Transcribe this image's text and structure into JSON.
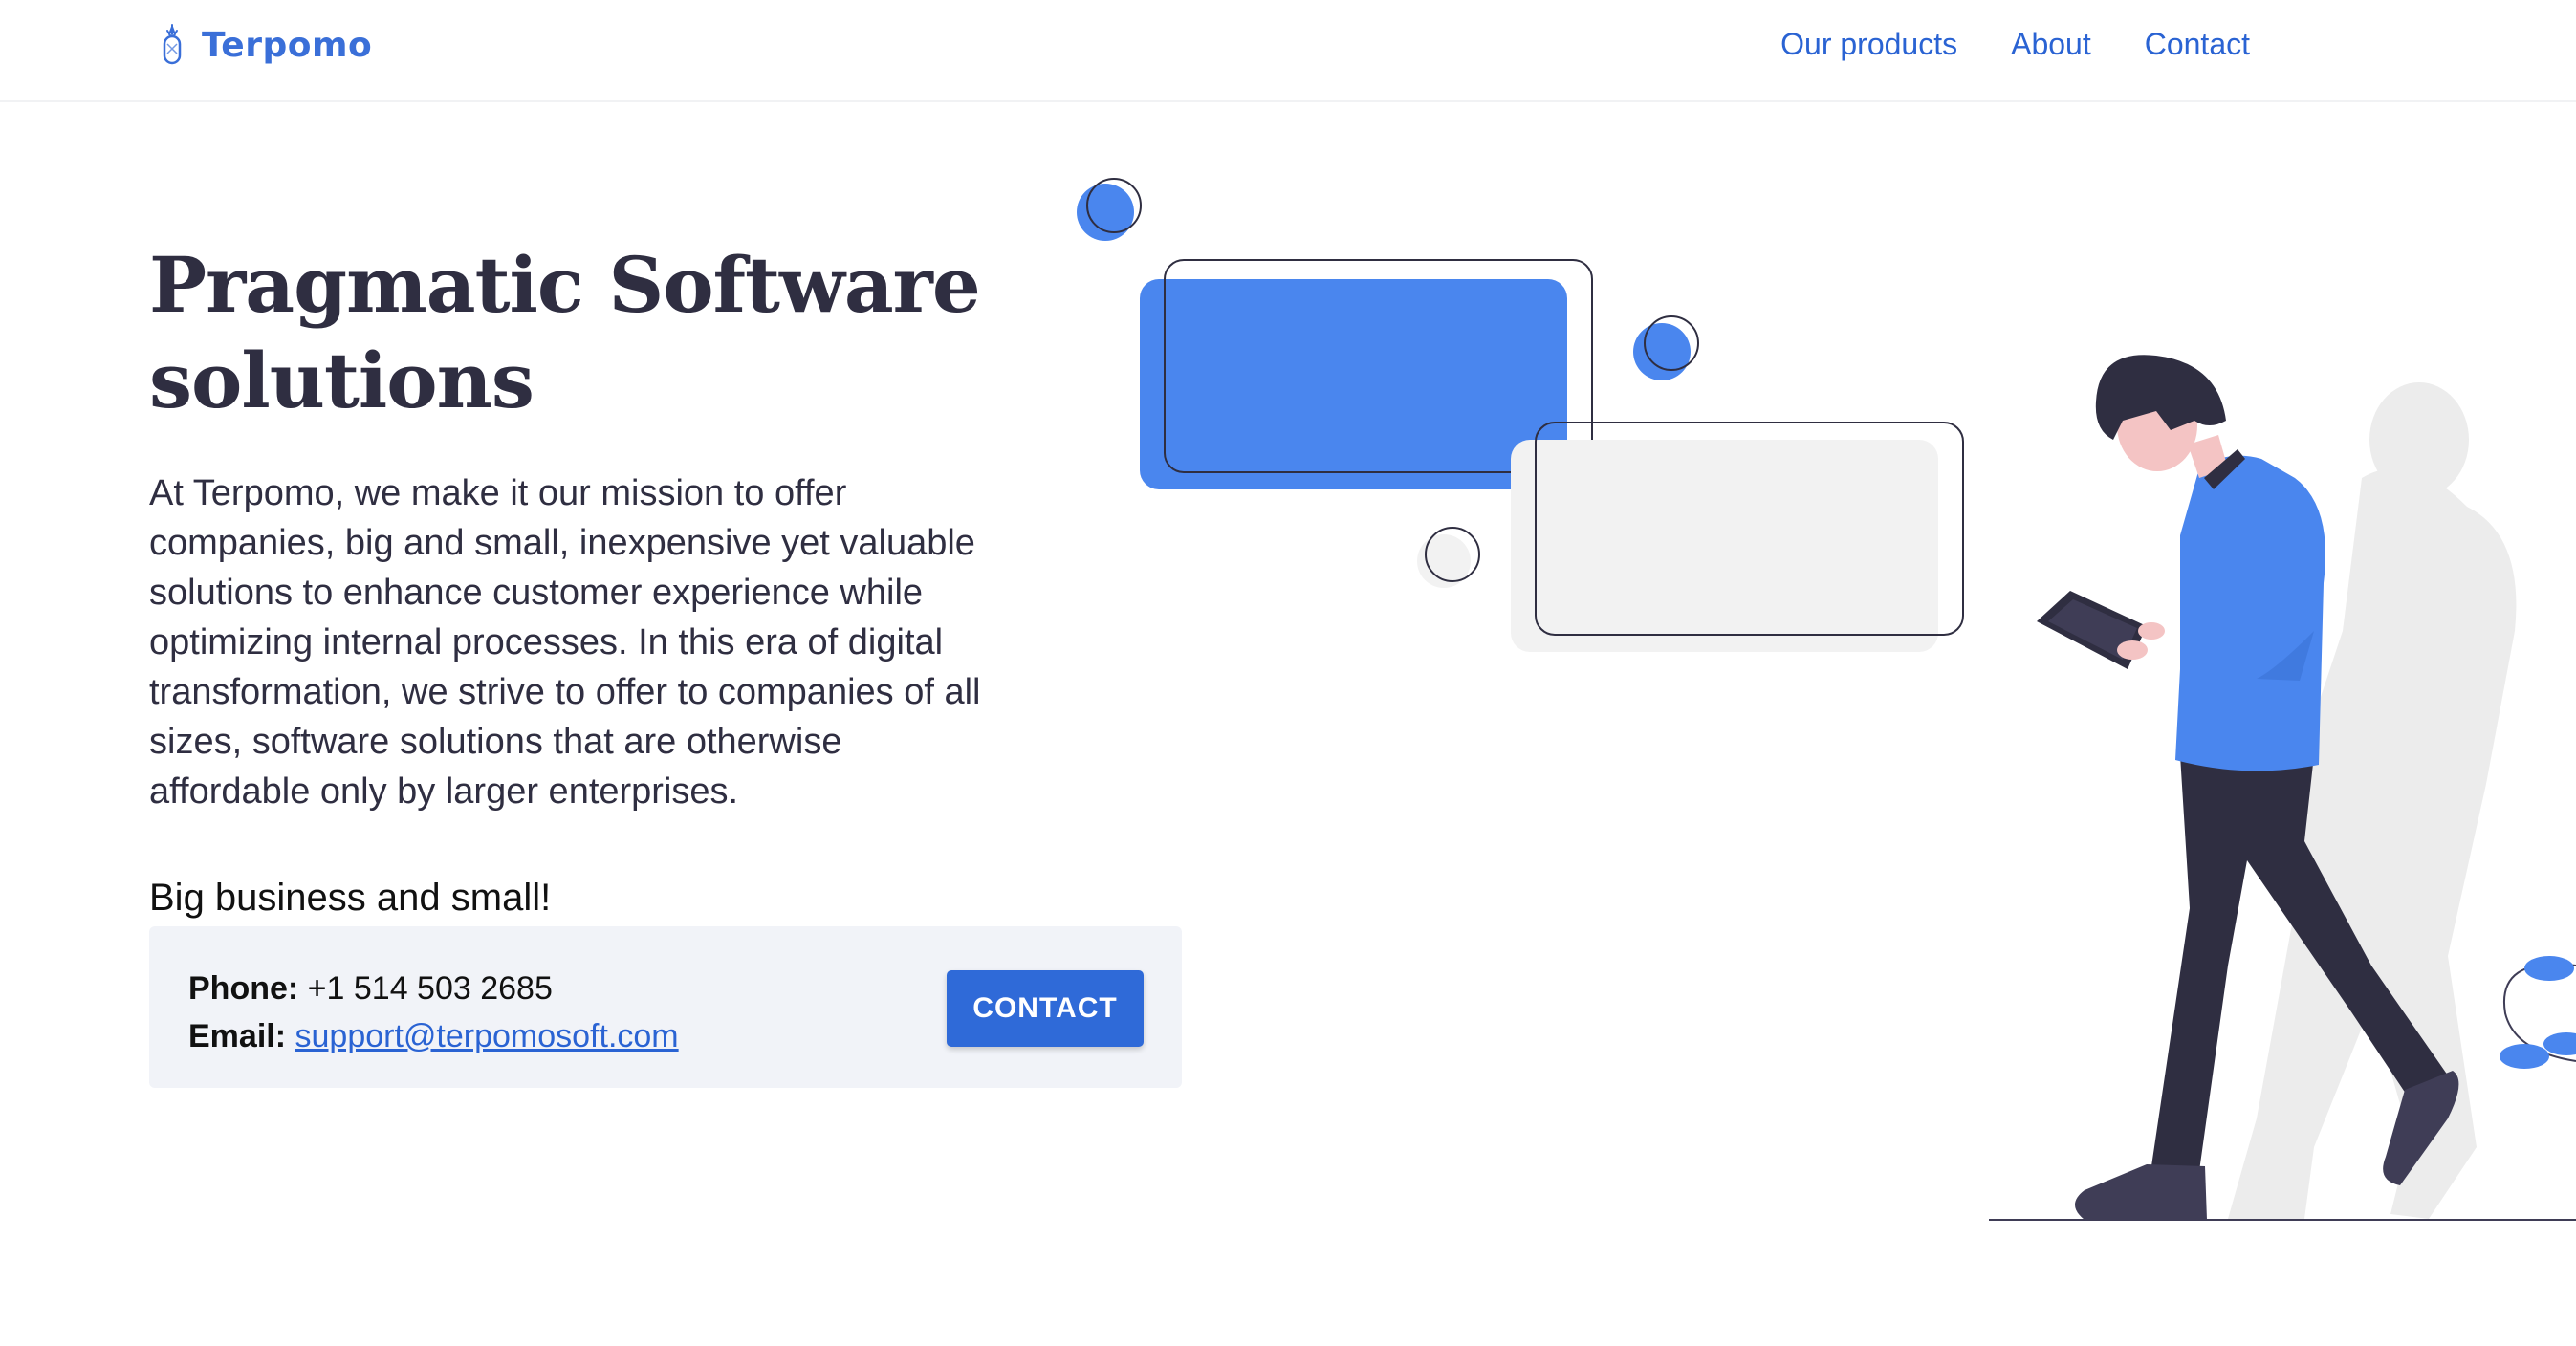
{
  "brand": {
    "name": "Terpomo",
    "icon": "pineapple-icon"
  },
  "nav": {
    "items": [
      {
        "label": "Our products"
      },
      {
        "label": "About"
      },
      {
        "label": "Contact"
      }
    ]
  },
  "hero": {
    "title": "Pragmatic Software solutions",
    "body": "At Terpomo, we make it our mission to offer companies, big and small, inexpensive yet valuable solutions to enhance customer experience while optimizing internal processes. In this era of digital transformation, we strive to offer to companies of all sizes, software solutions that are otherwise affordable only by larger enterprises.",
    "tagline": "Big business and small!"
  },
  "contact": {
    "phone_label": "Phone:",
    "phone_value": "+1 514 503 2685",
    "email_label": "Email:",
    "email_value": "support@terpomosoft.com",
    "button_label": "CONTACT"
  },
  "colors": {
    "accent": "#2a63d3",
    "illustration_blue": "#4a86ee",
    "dark": "#2f2e41",
    "card_bg": "#f1f3f8"
  }
}
